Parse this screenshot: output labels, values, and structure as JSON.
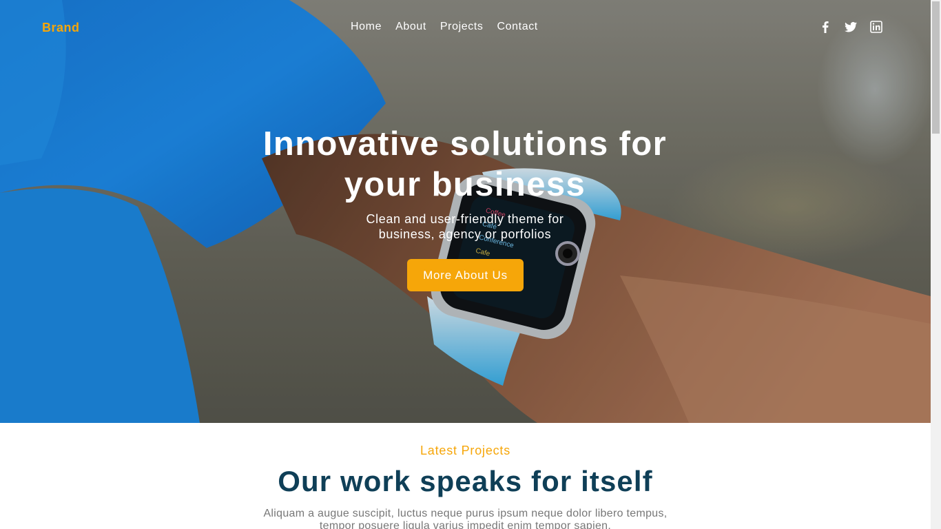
{
  "navbar": {
    "brand": "Brand",
    "links": [
      "Home",
      "About",
      "Projects",
      "Contact"
    ],
    "social_icons": [
      "facebook-icon",
      "twitter-icon",
      "linkedin-icon"
    ]
  },
  "hero": {
    "title": "Innovative solutions for your business",
    "subtitle": "Clean and user-friendly theme for business, agency or porfolios",
    "button_label": "More About Us",
    "background": "photo of a person in a blue shirt wearing a smartwatch"
  },
  "projects": {
    "eyebrow": "Latest Projects",
    "title": "Our work speaks for itself",
    "description": "Aliquam a augue suscipit, luctus neque purus ipsum neque dolor libero tempus, tempor posuere ligula varius impedit enim tempor sapien."
  },
  "colors": {
    "accent": "#f6a609",
    "heading": "#0f3f57",
    "body_text": "#777777"
  }
}
